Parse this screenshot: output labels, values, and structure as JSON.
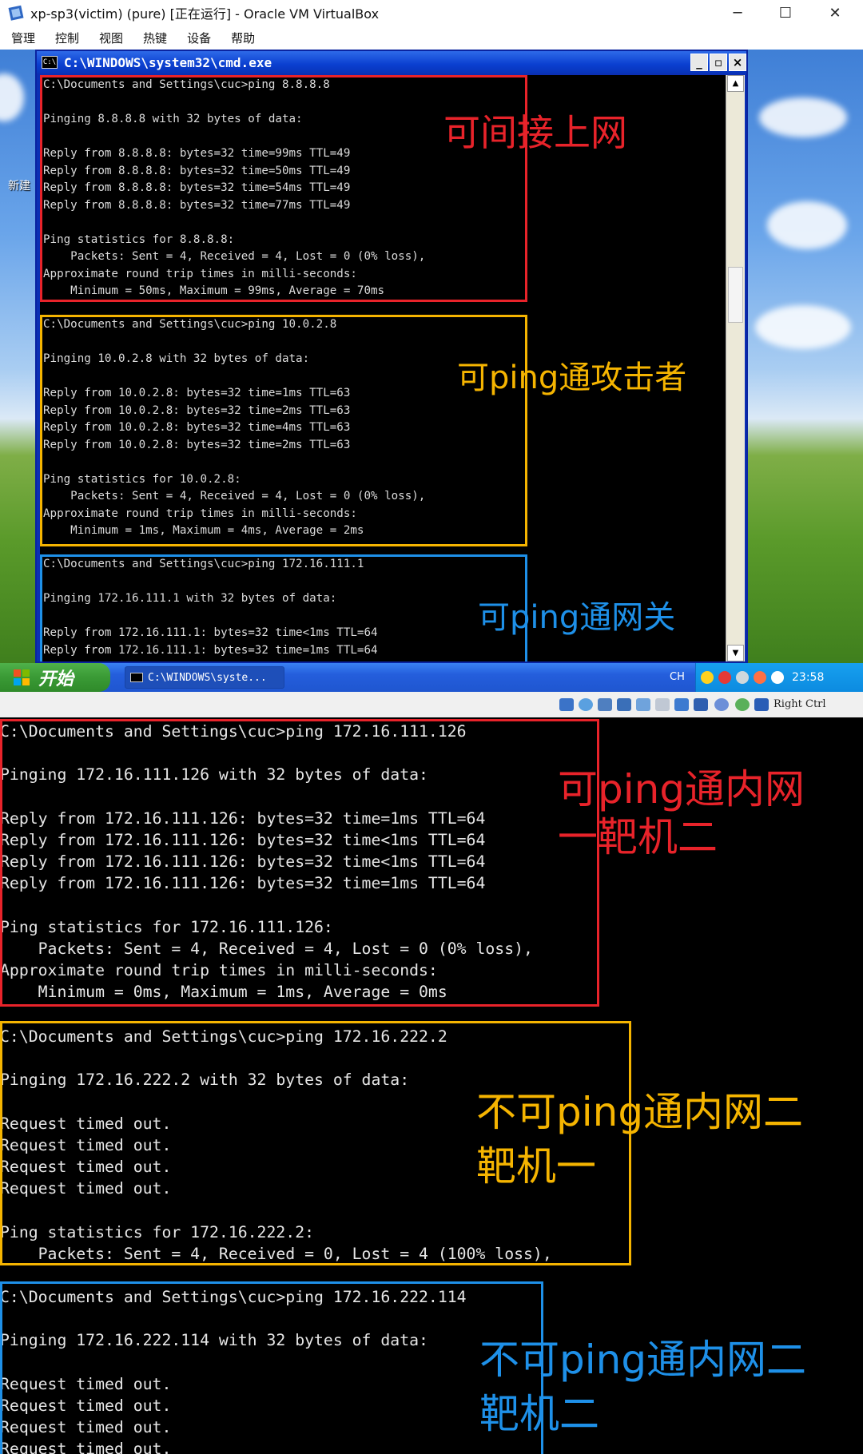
{
  "vbox": {
    "title": "xp-sp3(victim) (pure) [正在运行] - Oracle VM VirtualBox",
    "menu": [
      "管理",
      "控制",
      "视图",
      "热键",
      "设备",
      "帮助"
    ],
    "window_controls": [
      "─",
      "☐",
      "✕"
    ],
    "status": {
      "host_key": "Right Ctrl"
    }
  },
  "guest": {
    "desktop_label": "新建",
    "cmd": {
      "title": "C:\\WINDOWS\\system32\\cmd.exe",
      "buttons": [
        "_",
        "▫",
        "×"
      ],
      "blocks": [
        {
          "color": "#e8232a",
          "annotation": "可间接上网",
          "lines": [
            "C:\\Documents and Settings\\cuc>ping 8.8.8.8",
            "",
            "Pinging 8.8.8.8 with 32 bytes of data:",
            "",
            "Reply from 8.8.8.8: bytes=32 time=99ms TTL=49",
            "Reply from 8.8.8.8: bytes=32 time=50ms TTL=49",
            "Reply from 8.8.8.8: bytes=32 time=54ms TTL=49",
            "Reply from 8.8.8.8: bytes=32 time=77ms TTL=49",
            "",
            "Ping statistics for 8.8.8.8:",
            "    Packets: Sent = 4, Received = 4, Lost = 0 (0% loss),",
            "Approximate round trip times in milli-seconds:",
            "    Minimum = 50ms, Maximum = 99ms, Average = 70ms"
          ]
        },
        {
          "color": "#f5b400",
          "annotation": "可ping通攻击者",
          "lines": [
            "C:\\Documents and Settings\\cuc>ping 10.0.2.8",
            "",
            "Pinging 10.0.2.8 with 32 bytes of data:",
            "",
            "Reply from 10.0.2.8: bytes=32 time=1ms TTL=63",
            "Reply from 10.0.2.8: bytes=32 time=2ms TTL=63",
            "Reply from 10.0.2.8: bytes=32 time=4ms TTL=63",
            "Reply from 10.0.2.8: bytes=32 time=2ms TTL=63",
            "",
            "Ping statistics for 10.0.2.8:",
            "    Packets: Sent = 4, Received = 4, Lost = 0 (0% loss),",
            "Approximate round trip times in milli-seconds:",
            "    Minimum = 1ms, Maximum = 4ms, Average = 2ms"
          ]
        },
        {
          "color": "#1e90e8",
          "annotation": "可ping通网关",
          "lines": [
            "C:\\Documents and Settings\\cuc>ping 172.16.111.1",
            "",
            "Pinging 172.16.111.1 with 32 bytes of data:",
            "",
            "Reply from 172.16.111.1: bytes=32 time<1ms TTL=64",
            "Reply from 172.16.111.1: bytes=32 time=1ms TTL=64"
          ]
        }
      ]
    }
  },
  "taskbar": {
    "start_label": "开始",
    "task_label": "C:\\WINDOWS\\syste...",
    "lang": "CH",
    "clock": "23:58"
  },
  "console2": {
    "blocks": [
      {
        "color": "#e8232a",
        "annotation": [
          "可ping通内网",
          "一靶机二"
        ],
        "lines": [
          "C:\\Documents and Settings\\cuc>ping 172.16.111.126",
          "",
          "Pinging 172.16.111.126 with 32 bytes of data:",
          "",
          "Reply from 172.16.111.126: bytes=32 time=1ms TTL=64",
          "Reply from 172.16.111.126: bytes=32 time<1ms TTL=64",
          "Reply from 172.16.111.126: bytes=32 time<1ms TTL=64",
          "Reply from 172.16.111.126: bytes=32 time=1ms TTL=64",
          "",
          "Ping statistics for 172.16.111.126:",
          "    Packets: Sent = 4, Received = 4, Lost = 0 (0% loss),",
          "Approximate round trip times in milli-seconds:",
          "    Minimum = 0ms, Maximum = 1ms, Average = 0ms"
        ]
      },
      {
        "color": "#f5b400",
        "annotation": [
          "不可ping通内网二",
          "靶机一"
        ],
        "lines": [
          "C:\\Documents and Settings\\cuc>ping 172.16.222.2",
          "",
          "Pinging 172.16.222.2 with 32 bytes of data:",
          "",
          "Request timed out.",
          "Request timed out.",
          "Request timed out.",
          "Request timed out.",
          "",
          "Ping statistics for 172.16.222.2:",
          "    Packets: Sent = 4, Received = 0, Lost = 4 (100% loss),"
        ]
      },
      {
        "color": "#1e90e8",
        "annotation": [
          "不可ping通内网二",
          "靶机二"
        ],
        "lines": [
          "C:\\Documents and Settings\\cuc>ping 172.16.222.114",
          "",
          "Pinging 172.16.222.114 with 32 bytes of data:",
          "",
          "Request timed out.",
          "Request timed out.",
          "Request timed out.",
          "Request timed out."
        ]
      }
    ]
  }
}
